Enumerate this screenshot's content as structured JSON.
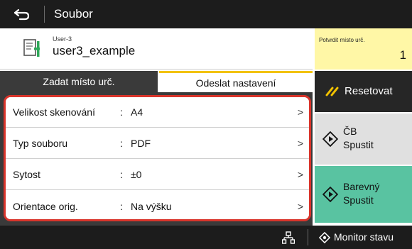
{
  "header": {
    "title": "Soubor",
    "back_icon": "back-arrow-icon"
  },
  "file": {
    "user_small": "User-3",
    "user_name": "user3_example",
    "icon": "document-icon"
  },
  "confirm": {
    "label": "Potvrdit místo urč.",
    "count": "1"
  },
  "tabs": [
    {
      "label": "Zadat místo urč.",
      "selected": false
    },
    {
      "label": "Odeslat nastavení",
      "selected": true
    }
  ],
  "settings": [
    {
      "label": "Velikost skenování",
      "value": "A4"
    },
    {
      "label": "Typ souboru",
      "value": "PDF"
    },
    {
      "label": "Sytost",
      "value": "±0"
    },
    {
      "label": "Orientace orig.",
      "value": "Na výšku"
    }
  ],
  "settings_separator": ":",
  "chevron": ">",
  "buttons": {
    "reset_label": "Resetovat",
    "bw_line1": "ČB",
    "bw_line2": "Spustit",
    "color_line1": "Barevný",
    "color_line2": "Spustit"
  },
  "bottom": {
    "monitor_label": "Monitor stavu"
  },
  "colors": {
    "dark_bar": "#1c1c1c",
    "tab_active_accent": "#f2c200",
    "highlight_frame": "#d9342b",
    "confirm_bg": "#fff7a6",
    "color_start_bg": "#59c3a1",
    "bw_start_bg": "#e0e0e0"
  }
}
